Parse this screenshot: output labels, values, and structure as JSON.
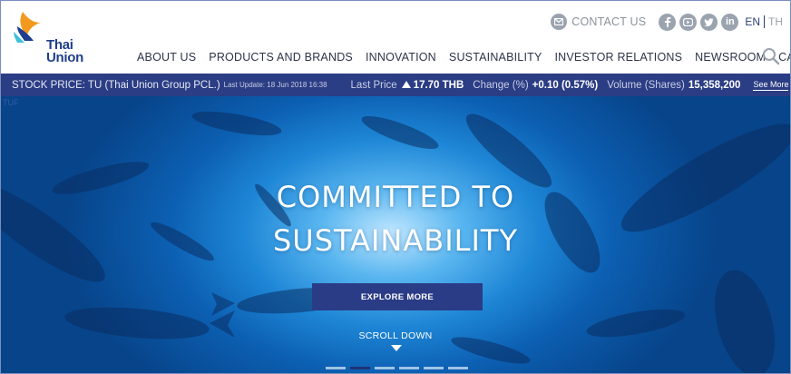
{
  "brand": {
    "logo_text_line1": "Thai",
    "logo_text_line2": "Union"
  },
  "topbar": {
    "contact_label": "CONTACT US",
    "social": [
      "facebook-icon",
      "youtube-icon",
      "twitter-icon",
      "linkedin-icon"
    ],
    "linkedin_glyph": "in",
    "lang_en": "EN",
    "lang_th": "TH"
  },
  "nav": {
    "items": [
      "ABOUT US",
      "PRODUCTS AND BRANDS",
      "INNOVATION",
      "SUSTAINABILITY",
      "INVESTOR RELATIONS",
      "NEWSROOM",
      "CAREERS"
    ]
  },
  "stock": {
    "label": "STOCK PRICE: TU (Thai Union Group PCL.)",
    "last_update": "Last Update: 18 Jun 2018 16:38",
    "last_price_label": "Last Price",
    "last_price_value": "17.70 THB",
    "change_label": "Change (%)",
    "change_value": "+0.10 (0.57%)",
    "volume_label": "Volume (Shares)",
    "volume_value": "15,358,200",
    "see_more": "See More"
  },
  "hero": {
    "broken_image_text": "TUF",
    "title_line1": "COMMITTED TO",
    "title_line2": "SUSTAINABILITY",
    "explore_label": "EXPLORE MORE",
    "scroll_label": "SCROLL DOWN",
    "slide_count": 6,
    "active_slide": 2
  },
  "colors": {
    "brand_blue": "#2b3d84",
    "logo_orange": "#f39a1e",
    "logo_navy": "#1f3e8c",
    "icon_grey": "#9aa3ae"
  }
}
